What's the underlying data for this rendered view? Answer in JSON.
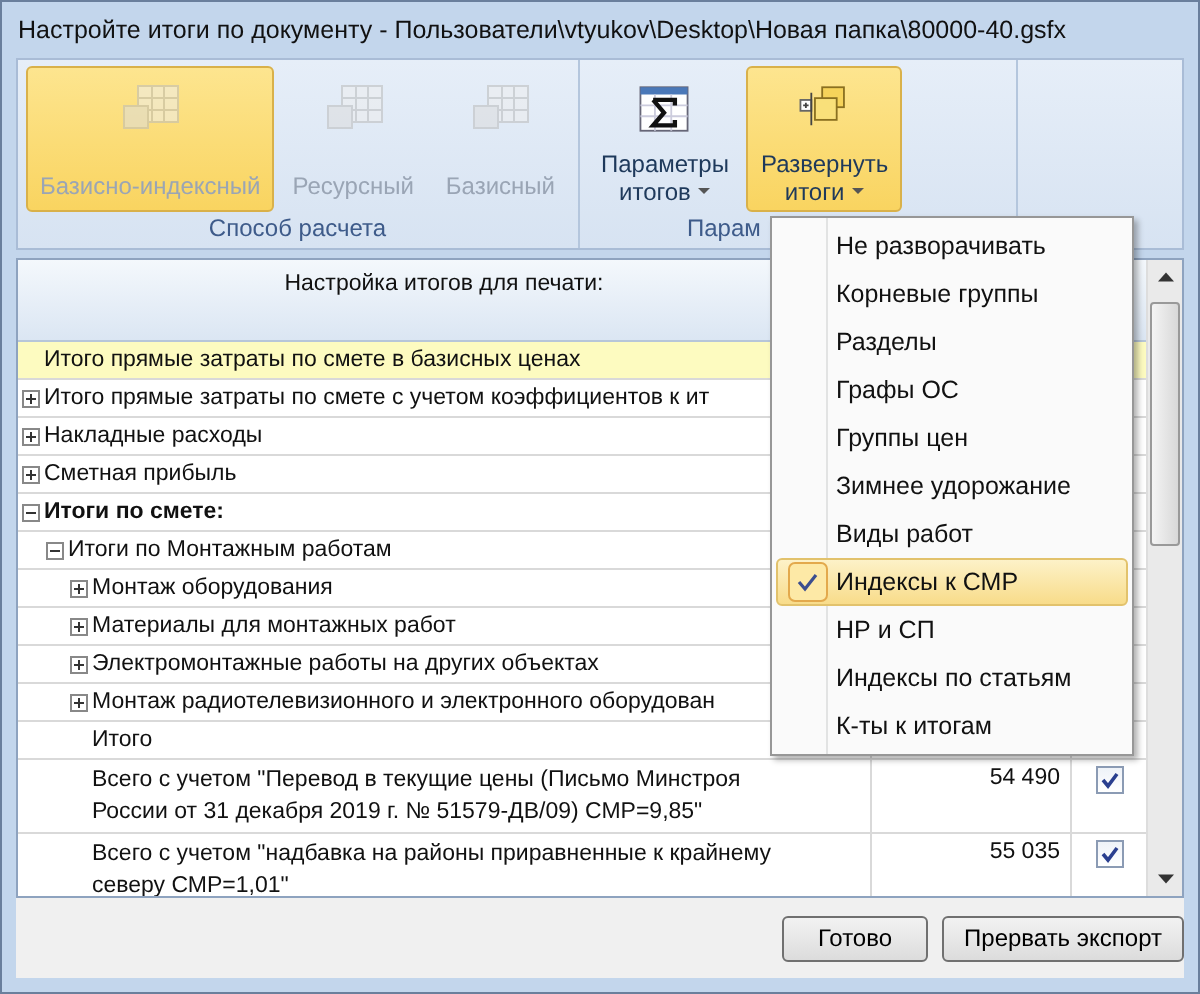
{
  "window": {
    "title": "Настройте итоги по документу - Пользователи\\vtyukov\\Desktop\\Новая папка\\80000-40.gsfx"
  },
  "ribbon": {
    "groups": [
      {
        "label": "Способ расчета",
        "buttons": [
          {
            "label": "Базисно-индексный",
            "kind": "table",
            "selected": true,
            "disabled": true
          },
          {
            "label": "Ресурсный",
            "kind": "table",
            "selected": false,
            "disabled": true
          },
          {
            "label": "Базисный",
            "kind": "table",
            "selected": false,
            "disabled": true
          }
        ]
      },
      {
        "label": "Парам",
        "buttons": [
          {
            "label": "Параметры итогов",
            "kind": "sigma",
            "selected": false,
            "disabled": false,
            "dropdown": true
          },
          {
            "label": "Развернуть итоги",
            "kind": "expand",
            "selected": true,
            "disabled": false,
            "dropdown": true
          }
        ]
      }
    ]
  },
  "table": {
    "header": "Настройка итогов для печати:",
    "rows": [
      {
        "label": "Итого прямые затраты по смете в базисных ценах",
        "selected": true
      },
      {
        "label": "Итого прямые затраты по смете с учетом коэффициентов к ит",
        "expanded": false,
        "selected": false
      },
      {
        "label": "Накладные расходы",
        "expanded": false,
        "selected": false
      },
      {
        "label": "Сметная прибыль",
        "expanded": false,
        "selected": false
      },
      {
        "label": "Итоги по смете:",
        "bold": true,
        "expanded": true,
        "selected": false,
        "children": [
          {
            "label": "Итоги по Монтажным работам",
            "expanded": true,
            "selected": false,
            "children": [
              {
                "label": "Монтаж оборудования",
                "expanded": false,
                "selected": false
              },
              {
                "label": "Материалы для монтажных работ",
                "expanded": false,
                "selected": false
              },
              {
                "label": "Электромонтажные работы на других объектах",
                "expanded": false,
                "selected": false
              },
              {
                "label": "Монтаж радиотелевизионного и электронного оборудован",
                "expanded": false,
                "selected": false
              },
              {
                "label": "Итого",
                "selected": false
              },
              {
                "label": "Всего с учетом \"Перевод в текущие цены (Письмо Минстроя России от 31 декабря 2019 г. № 51579-ДВ/09) СМР=9,85\"",
                "value": "54 490",
                "checked": true,
                "selected": false
              },
              {
                "label": "Всего с учетом \"надбавка на районы приравненные к крайнему северу СМР=1,01\"",
                "value": "55 035",
                "checked": true,
                "selected": false
              }
            ]
          }
        ]
      }
    ]
  },
  "menu": {
    "items": [
      {
        "label": "Не разворачивать",
        "checked": false
      },
      {
        "label": "Корневые группы",
        "checked": false
      },
      {
        "label": "Разделы",
        "checked": false
      },
      {
        "label": "Графы ОС",
        "checked": false
      },
      {
        "label": "Группы цен",
        "checked": false
      },
      {
        "label": "Зимнее удорожание",
        "checked": false
      },
      {
        "label": "Виды работ",
        "checked": false
      },
      {
        "label": "Индексы к СМР",
        "checked": true
      },
      {
        "label": "НР и СП",
        "checked": false
      },
      {
        "label": "Индексы по статьям",
        "checked": false
      },
      {
        "label": "К-ты к итогам",
        "checked": false
      }
    ]
  },
  "buttons": [
    "Готово",
    "Прервать экспорт"
  ]
}
